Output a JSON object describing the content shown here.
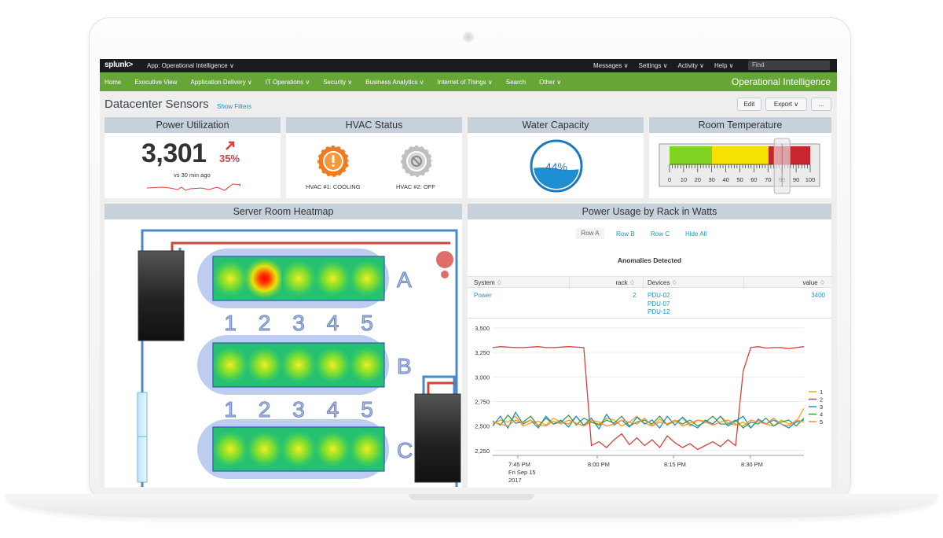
{
  "topbar": {
    "logo": "splunk>",
    "app": "App: Operational Intelligence ∨",
    "menus": [
      "Messages ∨",
      "Settings ∨",
      "Activity ∨",
      "Help ∨"
    ],
    "find_placeholder": "Find"
  },
  "nav": {
    "items": [
      "Home",
      "Executive View",
      "Application Delivery ∨",
      "IT Operations ∨",
      "Security ∨",
      "Business Analytics ∨",
      "Internet of Things ∨",
      "Search",
      "Other ∨"
    ],
    "brand": "Operational Intelligence"
  },
  "dashboard": {
    "title": "Datacenter Sensors",
    "show_filters": "Show Filters",
    "edit": "Edit",
    "export": "Export ∨",
    "more": "..."
  },
  "power": {
    "title": "Power Utilization",
    "value": "3,301",
    "trend": "35%",
    "caption": "vs 30 min ago"
  },
  "hvac": {
    "title": "HVAC Status",
    "unit1": "HVAC #1: COOLING",
    "unit2": "HVAC #2: OFF"
  },
  "water": {
    "title": "Water Capacity",
    "value": "44%",
    "level": 0.44
  },
  "temperature": {
    "title": "Room Temperature",
    "ticks": [
      "0",
      "10",
      "20",
      "30",
      "40",
      "50",
      "60",
      "70",
      "80",
      "90",
      "100"
    ],
    "value": 80,
    "colors": {
      "green": "#82d322",
      "yellow": "#f5e104",
      "red": "#c8262e"
    }
  },
  "heatmap": {
    "title": "Server Room Heatmap",
    "rows": [
      "A",
      "B",
      "C"
    ],
    "columns": [
      "1",
      "2",
      "3",
      "4",
      "5"
    ]
  },
  "rack": {
    "title": "Power Usage by Rack in Watts",
    "tabs": [
      "Row A",
      "Row B",
      "Row C",
      "Hide All"
    ],
    "anomalies_title": "Anomalies Detected",
    "table": {
      "headers": [
        "System ♢",
        "rack ♢",
        "Devices ♢",
        "value ♢"
      ],
      "row": {
        "system": "Power",
        "rack": "2",
        "devices": [
          "PDU-02",
          "PDU-07",
          "PDU-12"
        ],
        "value": "3400"
      }
    }
  },
  "chart_data": {
    "type": "line",
    "x": [
      "7:45 PM",
      "8:00 PM",
      "8:15 PM",
      "8:30 PM"
    ],
    "x_date_label": [
      "Fri Sep 15",
      "2017"
    ],
    "ylim": [
      2200,
      3500
    ],
    "yticks": [
      "2,250",
      "2,500",
      "2,750",
      "3,000",
      "3,250",
      "3,500"
    ],
    "legend_position": "right",
    "series": [
      {
        "name": "1",
        "color": "#f1a70c",
        "values": [
          2520,
          2560,
          2540,
          2600,
          2500,
          2530,
          2550,
          2510,
          2580,
          2540,
          2520,
          2600,
          2500,
          2540,
          2520,
          2580,
          2560,
          2500,
          2540,
          2600,
          2530,
          2500,
          2570,
          2520,
          2540,
          2580,
          2500,
          2560,
          2550,
          2520,
          2600,
          2530,
          2510,
          2540,
          2480,
          2560,
          2520,
          2500,
          2560,
          2520,
          2540,
          2680
        ]
      },
      {
        "name": "2",
        "color": "#d93f3c",
        "values": [
          3300,
          3310,
          3305,
          3300,
          3300,
          3305,
          3310,
          3300,
          3300,
          3305,
          3310,
          3305,
          3300,
          2300,
          2340,
          2280,
          2360,
          2420,
          2310,
          2380,
          2300,
          2360,
          2280,
          2400,
          2330,
          2280,
          2320,
          2260,
          2300,
          2340,
          2290,
          2360,
          2300,
          3060,
          3300,
          3310,
          3295,
          3300,
          3300,
          3290,
          3300,
          3310
        ]
      },
      {
        "name": "3",
        "color": "#1e93c6",
        "values": [
          2500,
          2600,
          2480,
          2640,
          2520,
          2560,
          2480,
          2600,
          2520,
          2560,
          2490,
          2600,
          2510,
          2580,
          2470,
          2620,
          2510,
          2560,
          2490,
          2590,
          2520,
          2560,
          2480,
          2600,
          2510,
          2590,
          2520,
          2480,
          2560,
          2520,
          2600,
          2500,
          2550,
          2600,
          2480,
          2570,
          2520,
          2560,
          2520,
          2480,
          2540,
          2560
        ]
      },
      {
        "name": "4",
        "color": "#3c9b4a",
        "values": [
          2550,
          2510,
          2610,
          2530,
          2540,
          2600,
          2500,
          2580,
          2520,
          2540,
          2610,
          2510,
          2580,
          2540,
          2510,
          2560,
          2530,
          2600,
          2500,
          2540,
          2560,
          2520,
          2600,
          2510,
          2560,
          2520,
          2560,
          2500,
          2540,
          2600,
          2520,
          2520,
          2560,
          2480,
          2540,
          2520,
          2580,
          2500,
          2540,
          2560,
          2500,
          2580
        ]
      },
      {
        "name": "5",
        "color": "#f58f39",
        "values": [
          2540,
          2520,
          2500,
          2560,
          2530,
          2560,
          2510,
          2500,
          2550,
          2520,
          2560,
          2530,
          2500,
          2560,
          2540,
          2500,
          2520,
          2560,
          2540,
          2520,
          2580,
          2500,
          2540,
          2520,
          2560,
          2500,
          2530,
          2560,
          2540,
          2510,
          2540,
          2560,
          2520,
          2500,
          2560,
          2540,
          2520,
          2580,
          2520,
          2500,
          2560,
          2540
        ]
      }
    ]
  }
}
